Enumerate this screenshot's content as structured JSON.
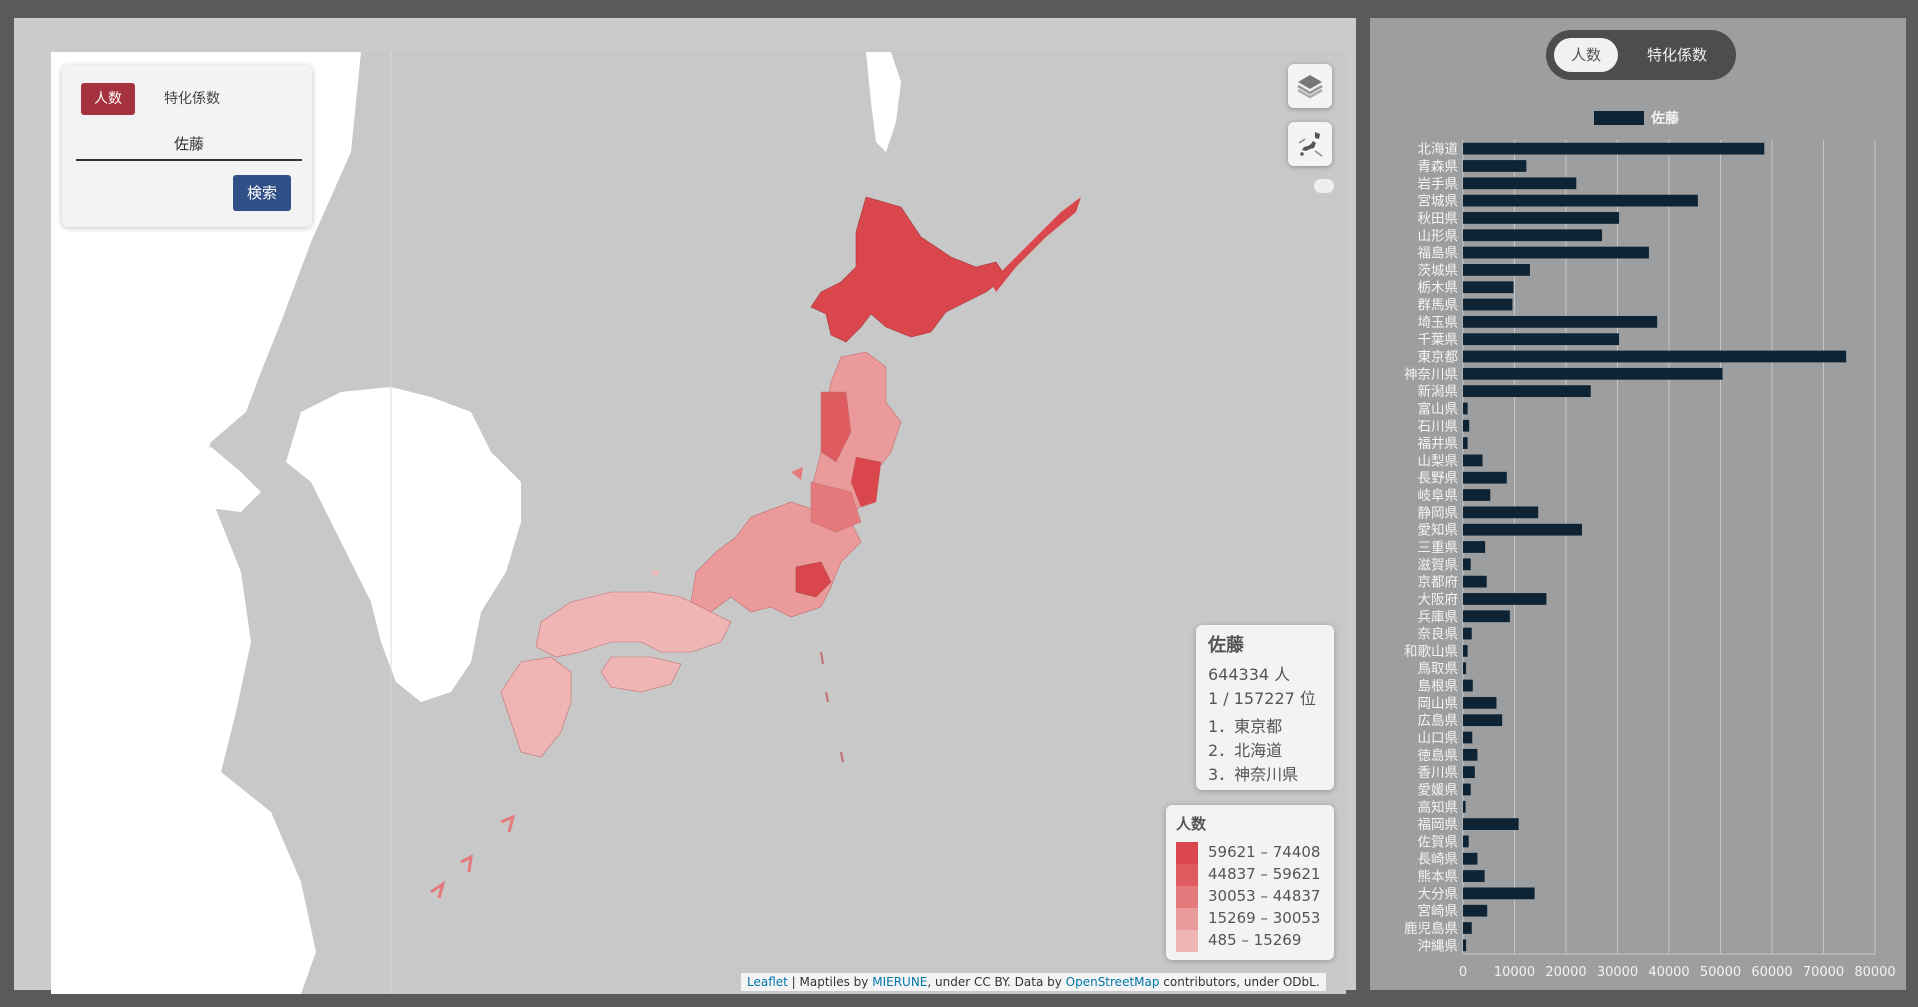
{
  "search": {
    "mode_count_label": "人数",
    "mode_coef_label": "特化係数",
    "query_value": "佐藤",
    "search_button_label": "検索"
  },
  "info": {
    "title": "佐藤",
    "count_text": "644334 人",
    "rank_text": "1 / 157227 位",
    "top": [
      "1．東京都",
      "2．北海道",
      "3．神奈川県"
    ]
  },
  "legend": {
    "title": "人数",
    "items": [
      {
        "range": "59621 – 74408",
        "color": "#d9474d"
      },
      {
        "range": "44837 – 59621",
        "color": "#de5b5f"
      },
      {
        "range": "30053 – 44837",
        "color": "#e47a7b"
      },
      {
        "range": "15269 – 30053",
        "color": "#ea9a9a"
      },
      {
        "range": "485 – 15269",
        "color": "#efb5b4"
      }
    ]
  },
  "attribution": {
    "leaflet": "Leaflet",
    "sep": " | Maptiles by ",
    "mierune": "MIERUNE",
    "mid": ", under CC BY. Data by ",
    "osm": "OpenStreetMap",
    "end": " contributors, under ODbL."
  },
  "chart_toggle": {
    "count_label": "人数",
    "coef_label": "特化係数"
  },
  "colors": {
    "bar": "#0e2434",
    "accent": "#a4313d",
    "button": "#2f4f86"
  },
  "icons": {
    "layers": "layers-icon",
    "japan": "japan-map-icon"
  },
  "chart_data": {
    "type": "bar",
    "orientation": "horizontal",
    "legend": "佐藤",
    "xlim": [
      0,
      80000
    ],
    "xticks": [
      0,
      10000,
      20000,
      30000,
      40000,
      50000,
      60000,
      70000,
      80000
    ],
    "grid": true,
    "categories": [
      "北海道",
      "青森県",
      "岩手県",
      "宮城県",
      "秋田県",
      "山形県",
      "福島県",
      "茨城県",
      "栃木県",
      "群馬県",
      "埼玉県",
      "千葉県",
      "東京都",
      "神奈川県",
      "新潟県",
      "富山県",
      "石川県",
      "福井県",
      "山梨県",
      "長野県",
      "岐阜県",
      "静岡県",
      "愛知県",
      "三重県",
      "滋賀県",
      "京都府",
      "大阪府",
      "兵庫県",
      "奈良県",
      "和歌山県",
      "鳥取県",
      "島根県",
      "岡山県",
      "広島県",
      "山口県",
      "徳島県",
      "香川県",
      "愛媛県",
      "高知県",
      "福岡県",
      "佐賀県",
      "長崎県",
      "熊本県",
      "大分県",
      "宮崎県",
      "鹿児島県",
      "沖縄県"
    ],
    "values": [
      58500,
      12300,
      22000,
      45600,
      30300,
      27000,
      36100,
      13000,
      9800,
      9600,
      37700,
      30300,
      74400,
      50400,
      24800,
      900,
      1200,
      900,
      3800,
      8500,
      5300,
      14600,
      23100,
      4300,
      1500,
      4600,
      16200,
      9100,
      1700,
      900,
      600,
      1900,
      6500,
      7600,
      1800,
      2800,
      2300,
      1500,
      500,
      10800,
      1100,
      2800,
      4200,
      13900,
      4700,
      1700,
      600
    ]
  }
}
